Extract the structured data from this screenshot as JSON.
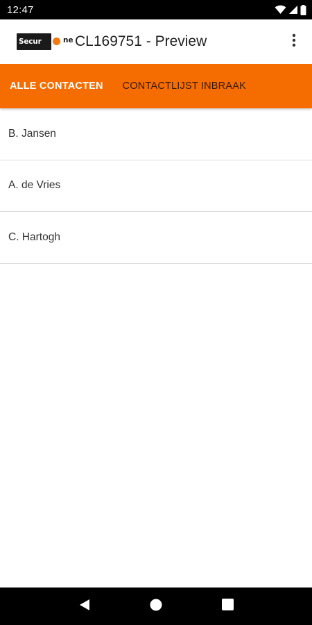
{
  "status_bar": {
    "time": "12:47",
    "icons": [
      "wifi-icon",
      "signal-icon",
      "battery-icon"
    ]
  },
  "app_bar": {
    "logo_text_left": "Secur",
    "logo_text_right": "ne",
    "title": "CL169751 - Preview",
    "overflow_icon": "more-vert-icon"
  },
  "tabs": [
    {
      "label": "ALLE CONTACTEN",
      "active": true
    },
    {
      "label": "CONTACTLIJST INBRAAK",
      "active": false
    }
  ],
  "contacts": [
    {
      "name": "B. Jansen"
    },
    {
      "name": "A. de Vries"
    },
    {
      "name": "C. Hartogh"
    }
  ],
  "nav_bar": {
    "icons": [
      "back-icon",
      "home-icon",
      "recents-icon"
    ]
  },
  "colors": {
    "accent": "#f56c00",
    "status_bar": "#000000",
    "nav_bar": "#000000"
  }
}
